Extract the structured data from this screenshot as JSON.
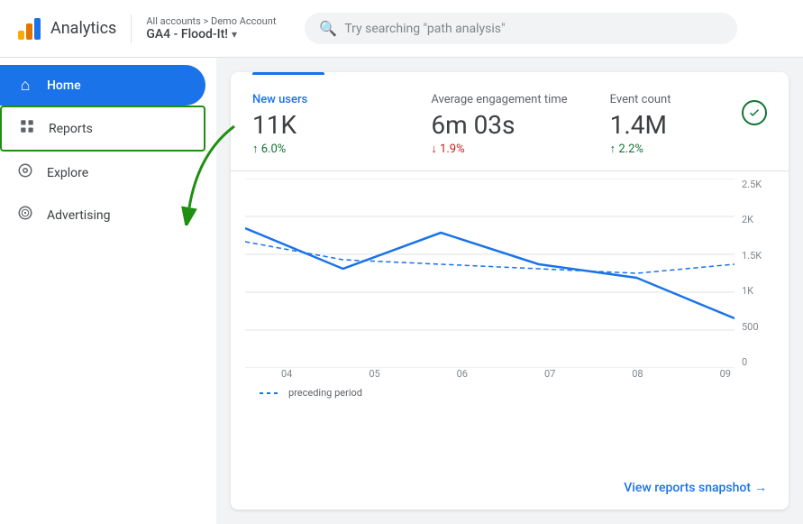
{
  "header": {
    "app_name": "Analytics",
    "breadcrumb": "All accounts > Demo Account",
    "account_name": "GA4 - Flood-It!",
    "search_placeholder": "Try searching \"path analysis\""
  },
  "sidebar": {
    "items": [
      {
        "id": "home",
        "label": "Home",
        "icon": "🏠",
        "active": true
      },
      {
        "id": "reports",
        "label": "Reports",
        "icon": "📊",
        "highlighted": true
      },
      {
        "id": "explore",
        "label": "Explore",
        "icon": "🔍"
      },
      {
        "id": "advertising",
        "label": "Advertising",
        "icon": "📡"
      }
    ]
  },
  "metrics": [
    {
      "label": "New users",
      "value": "11K",
      "change": "↑ 6.0%",
      "trend": "up",
      "label_style": "blue"
    },
    {
      "label": "Average engagement time",
      "value": "6m 03s",
      "change": "↓ 1.9%",
      "trend": "down",
      "label_style": "normal"
    },
    {
      "label": "Event count",
      "value": "1.4M",
      "change": "↑ 2.2%",
      "trend": "up",
      "label_style": "normal"
    }
  ],
  "chart": {
    "y_labels": [
      "2.5K",
      "2K",
      "1.5K",
      "1K",
      "500",
      "0"
    ],
    "x_labels": [
      "04",
      "05",
      "06",
      "07",
      "08",
      "09"
    ],
    "legend": {
      "solid_label": "",
      "dashed_label": "preceding period"
    }
  },
  "footer": {
    "view_reports_label": "View reports snapshot",
    "arrow": "→"
  }
}
